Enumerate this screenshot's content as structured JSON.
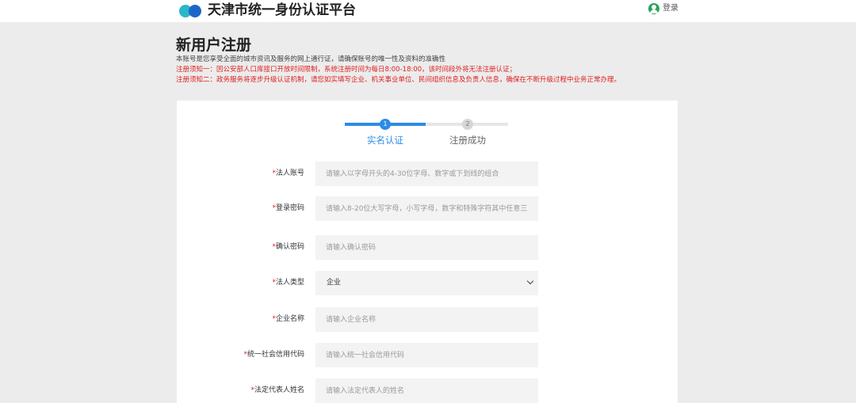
{
  "header": {
    "site_title": "天津市统一身份认证平台",
    "login_label": "登录"
  },
  "intro": {
    "title": "新用户注册",
    "description": "本账号是您享受全面的城市资讯及服务的网上通行证，请确保账号的唯一性及资料的准确性",
    "notice_1": "注册须知一：因公安部人口库接口开放时间限制，系统注册时间为每日8:00-18:00，该时间段外将无法注册认证；",
    "notice_2": "注册须知二：政务服务将逐步升级认证机制，请您如实填写企业、机关事业单位、民间组织信息及负责人信息，确保在不断升级过程中业务正常办理。"
  },
  "steps": [
    {
      "number": "1",
      "label": "实名认证",
      "state": "active"
    },
    {
      "number": "2",
      "label": "注册成功",
      "state": "inactive"
    }
  ],
  "form": {
    "required_mark": "*",
    "account": {
      "label": "法人账号",
      "value": "",
      "placeholder": "请输入以字母开头的4-30位字母、数字或下划线的组合"
    },
    "password": {
      "label": "登录密码",
      "value": "",
      "placeholder": "请输入8-20位大写字母，小写字母，数字和特殊字符其中任意三"
    },
    "confirm_password": {
      "label": "确认密码",
      "value": "",
      "placeholder": "请输入确认密码"
    },
    "legal_type": {
      "label": "法人类型",
      "selected": "企业"
    },
    "company_name": {
      "label": "企业名称",
      "value": "",
      "placeholder": "请输入企业名称"
    },
    "credit_code": {
      "label": "统一社会信用代码",
      "value": "",
      "placeholder": "请输入统一社会信用代码"
    },
    "legal_rep_name": {
      "label": "法定代表人姓名",
      "value": "",
      "placeholder": "请输入法定代表人的姓名"
    }
  },
  "colors": {
    "accent": "#2c8be7",
    "warning": "#e02020",
    "background": "#ececec",
    "field_background": "#f3f3f3"
  }
}
